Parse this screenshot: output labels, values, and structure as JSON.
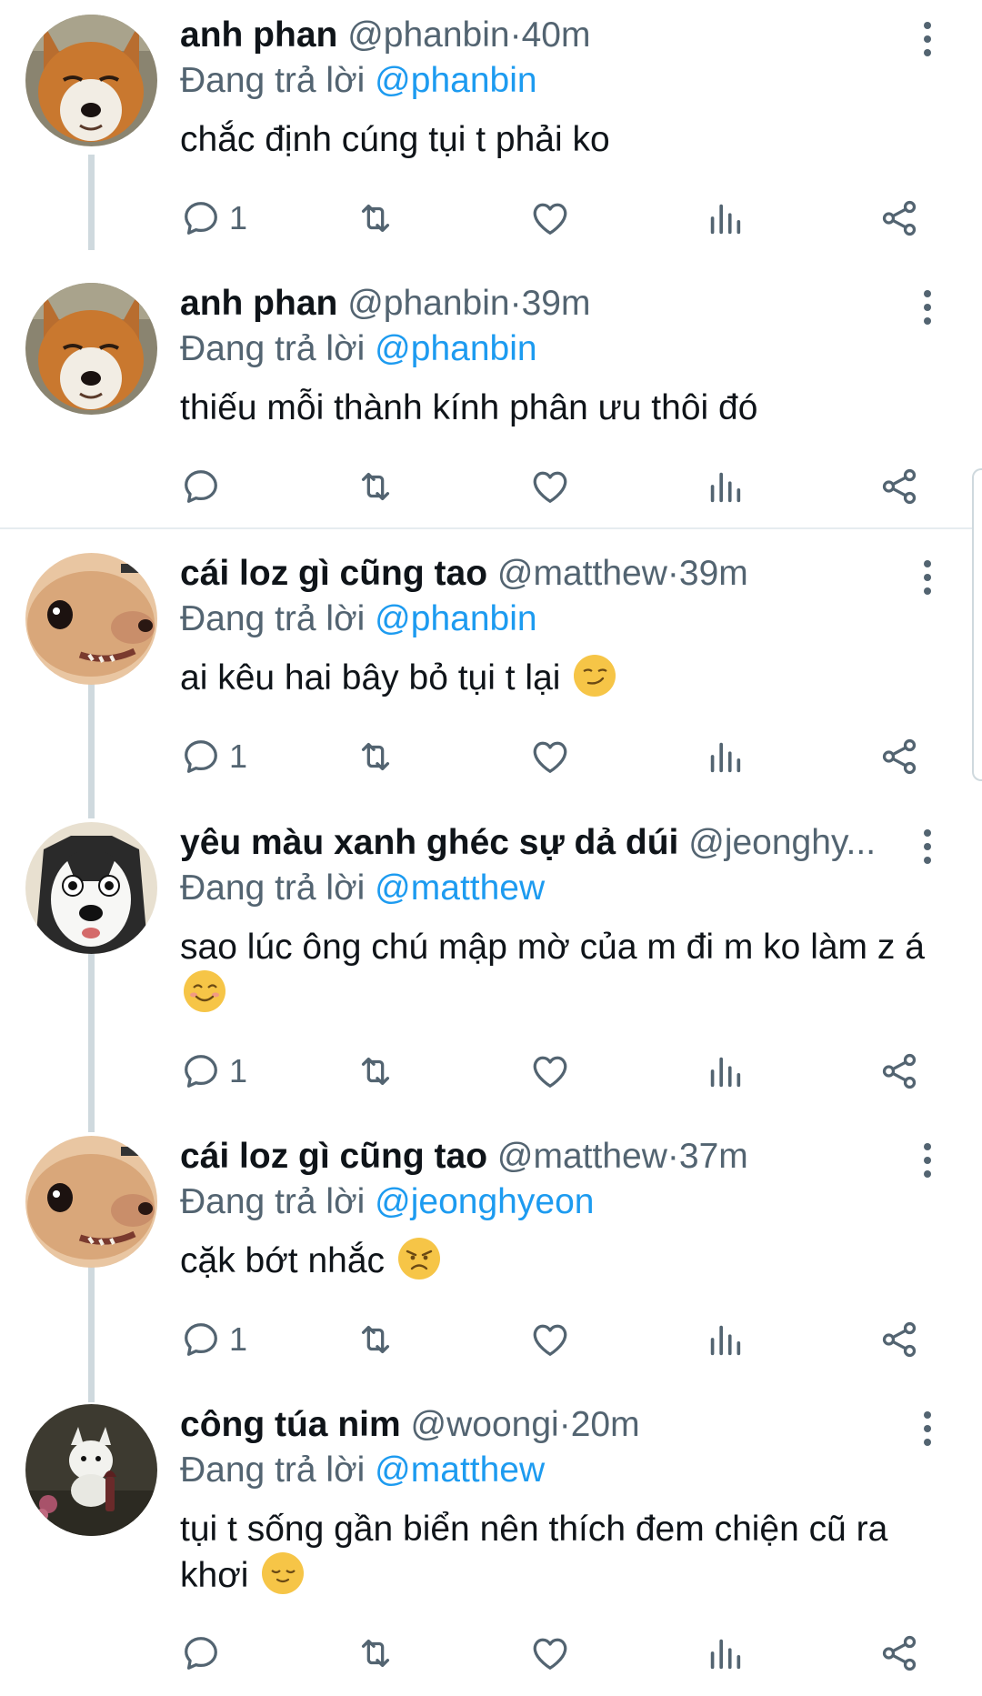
{
  "colors": {
    "accent": "#1d9bf0",
    "secondary_text": "#536471",
    "primary_text": "#0f1419",
    "thread_line": "#cfd9de"
  },
  "tweets": [
    {
      "display_name": "anh phan",
      "handle": "@phanbin",
      "time": "40m",
      "reply_prefix": "Đang trả lời",
      "reply_target": "@phanbin",
      "text": "chắc định cúng tụi t phải ko",
      "emoji": "",
      "reply_count": "1",
      "avatar": "fox-avatar"
    },
    {
      "display_name": "anh phan",
      "handle": "@phanbin",
      "time": "39m",
      "reply_prefix": "Đang trả lời",
      "reply_target": "@phanbin",
      "text": "thiếu mỗi thành kính phân ưu thôi đó",
      "emoji": "",
      "reply_count": "",
      "avatar": "fox-avatar"
    },
    {
      "display_name": "cái loz gì cũng tao",
      "handle": "@matthew",
      "time": "39m",
      "reply_prefix": "Đang trả lời",
      "reply_target": "@phanbin",
      "text": "ai kêu hai bây bỏ tụi t lại",
      "emoji": "smirking-face",
      "reply_count": "1",
      "avatar": "dog-avatar"
    },
    {
      "display_name": "yêu màu xanh ghéc sự dả dúi",
      "handle": "@jeonghy...",
      "time": "",
      "reply_prefix": "Đang trả lời",
      "reply_target": "@matthew",
      "text": "sao lúc ông chú mập mờ của m đi m ko làm z á",
      "emoji": "smiling-face",
      "reply_count": "1",
      "avatar": "husky-avatar"
    },
    {
      "display_name": "cái loz gì cũng tao",
      "handle": "@matthew",
      "time": "37m",
      "reply_prefix": "Đang trả lời",
      "reply_target": "@jeonghyeon",
      "text": "cặk bớt nhắc",
      "emoji": "angry-face",
      "reply_count": "1",
      "avatar": "dog-avatar"
    },
    {
      "display_name": "công túa nim",
      "handle": "@woongi",
      "time": "20m",
      "reply_prefix": "Đang trả lời",
      "reply_target": "@matthew",
      "text": "tụi t sống gần biển nên thích đem chiện cũ ra khơi",
      "emoji": "relieved-face",
      "reply_count": "",
      "avatar": "white-dog-avatar"
    }
  ],
  "icons": {
    "reply": "reply-icon",
    "retweet": "retweet-icon",
    "like": "heart-icon",
    "views": "views-icon",
    "share": "share-icon",
    "more": "more-icon"
  },
  "separator": "·"
}
